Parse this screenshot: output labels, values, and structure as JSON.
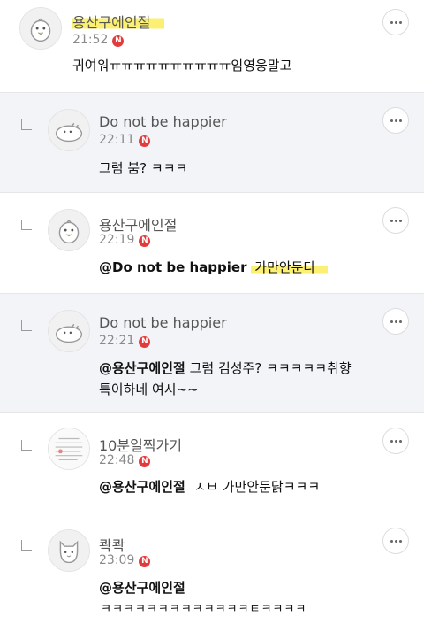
{
  "comments": [
    {
      "author": "용산구에인절",
      "time": "21:52",
      "badge": "N",
      "text": "귀여워ㅠㅠㅠㅠㅠㅠㅠㅠㅠㅠ임영웅말고"
    },
    {
      "author": "Do not be happier",
      "time": "22:11",
      "badge": "N",
      "text": "그럼 붐? ㅋㅋㅋ"
    },
    {
      "author": "용산구에인절",
      "time": "22:19",
      "badge": "N",
      "mention": "@Do not be happier",
      "text": "가만안둔다"
    },
    {
      "author": "Do not be happier",
      "time": "22:21",
      "badge": "N",
      "mention": "@용산구에인절",
      "text": "그럼 김성주? ㅋㅋㅋㅋㅋ취향",
      "text2": "특이하네 여시~~"
    },
    {
      "author": "10분일찍가기",
      "time": "22:48",
      "badge": "N",
      "mention": "@용산구에인절",
      "text": "ㅅㅂ 가만안둔닭ㅋㅋㅋ"
    },
    {
      "author": "콱콱",
      "time": "23:09",
      "badge": "N",
      "mention": "@용산구에인절",
      "text2": "ㅋㅋㅋㅋㅋㅋㅋㅋㅋㅋㅋㅋㅋㅌㅋㅋㅋㅋ"
    }
  ],
  "colors": {
    "reply_bg": "#f2f4f8",
    "badge": "#e33b3b",
    "highlight": "#faee5a"
  },
  "icons": {
    "more": "more-horizontal-icon",
    "reply": "reply-arrow-icon",
    "new": "new-badge-icon"
  }
}
